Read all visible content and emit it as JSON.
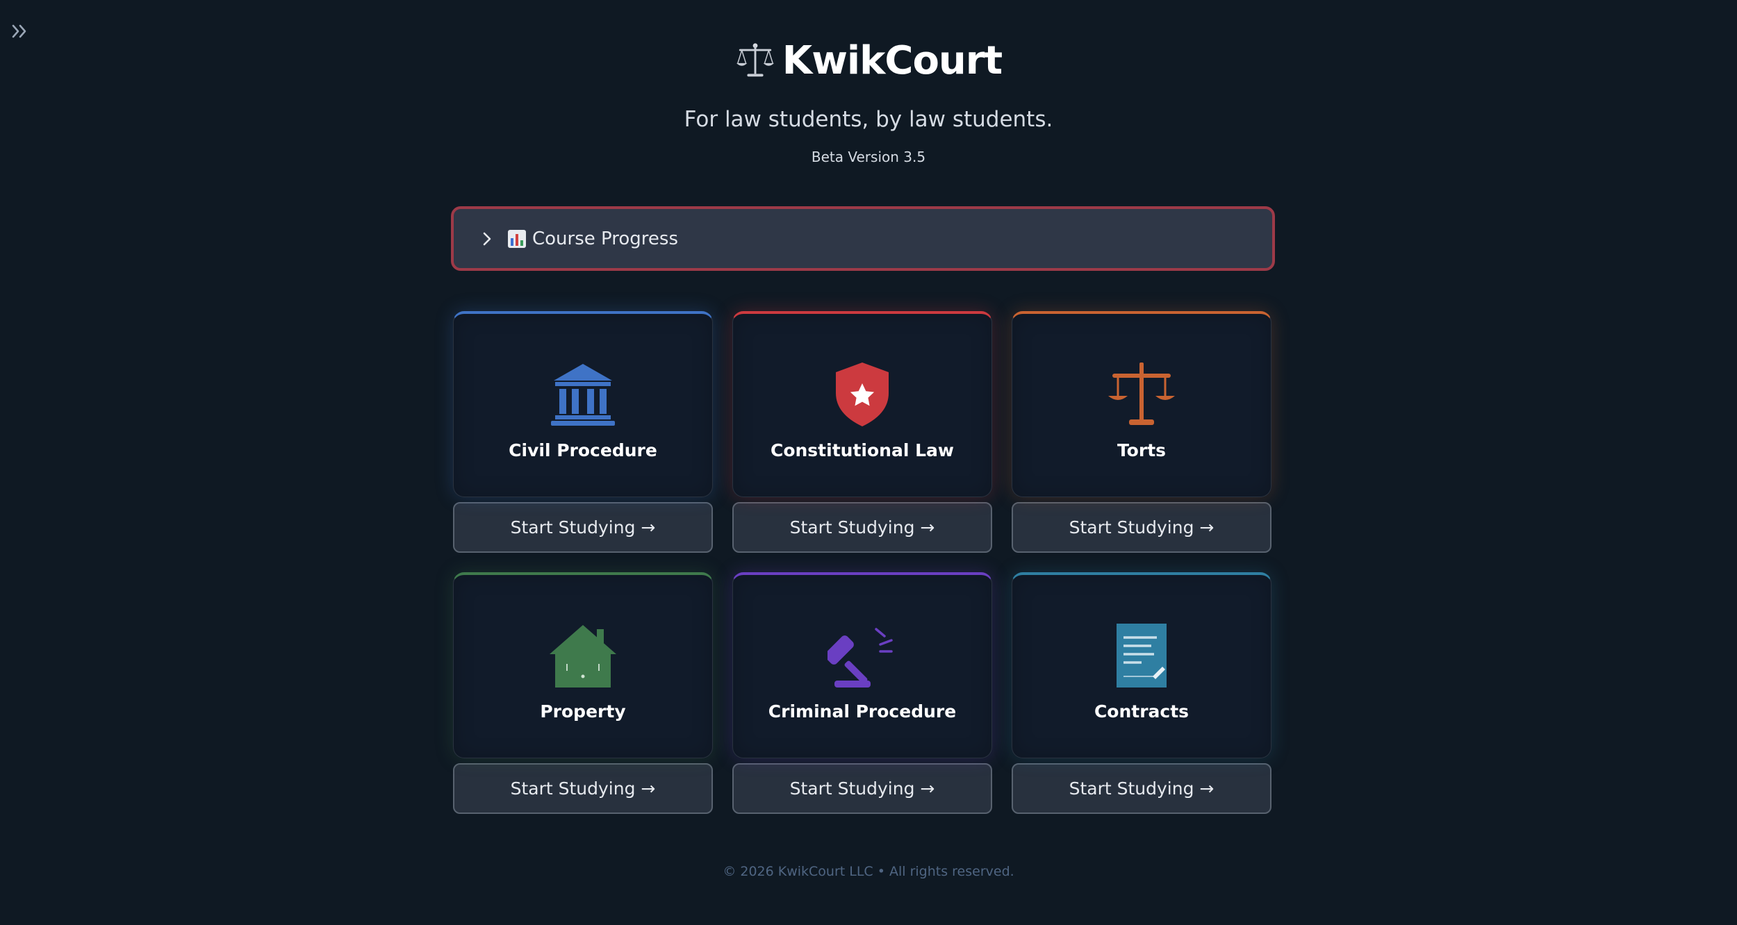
{
  "sidebar": {
    "toggle_icon": "double-chevron-right-icon"
  },
  "header": {
    "logo_icon": "balance-scale-icon",
    "title": "KwikCourt",
    "tagline": "For law students, by law students.",
    "version": "Beta Version 3.5"
  },
  "progress": {
    "chevron_icon": "chevron-right-icon",
    "icon": "bar-chart-icon",
    "label": "Course Progress",
    "border_color": "#9d3a48"
  },
  "courses": [
    {
      "title": "Civil Procedure",
      "icon": "courthouse-icon",
      "accent": "#3f73c6",
      "button": "Start Studying →"
    },
    {
      "title": "Constitutional Law",
      "icon": "shield-star-icon",
      "accent": "#cc3a3f",
      "button": "Start Studying →"
    },
    {
      "title": "Torts",
      "icon": "scales-icon",
      "accent": "#c96331",
      "button": "Start Studying →"
    },
    {
      "title": "Property",
      "icon": "house-icon",
      "accent": "#3f7a4c",
      "button": "Start Studying →"
    },
    {
      "title": "Criminal Procedure",
      "icon": "gavel-icon",
      "accent": "#6a3fc2",
      "button": "Start Studying →"
    },
    {
      "title": "Contracts",
      "icon": "document-pen-icon",
      "accent": "#2f7fa2",
      "button": "Start Studying →"
    }
  ],
  "footer": {
    "text": "© 2026 KwikCourt LLC • All rights reserved."
  }
}
